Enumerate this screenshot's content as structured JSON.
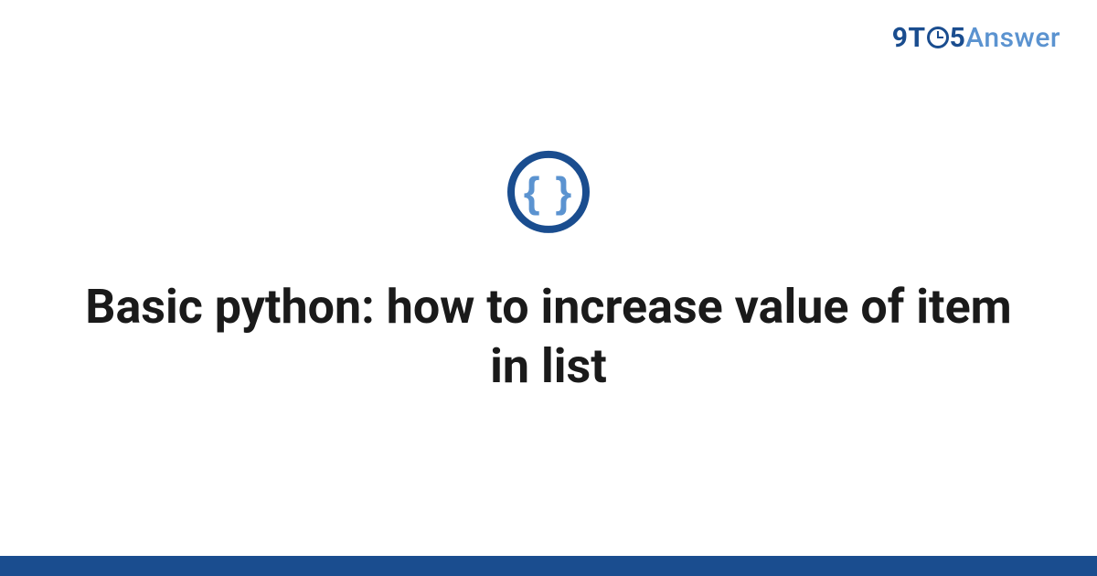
{
  "logo": {
    "part1": "9",
    "part2": "T",
    "part3": "5",
    "part4": "Answer"
  },
  "icon": {
    "braces_glyph": "{ }"
  },
  "main": {
    "title": "Basic python: how to increase value of item in list"
  }
}
